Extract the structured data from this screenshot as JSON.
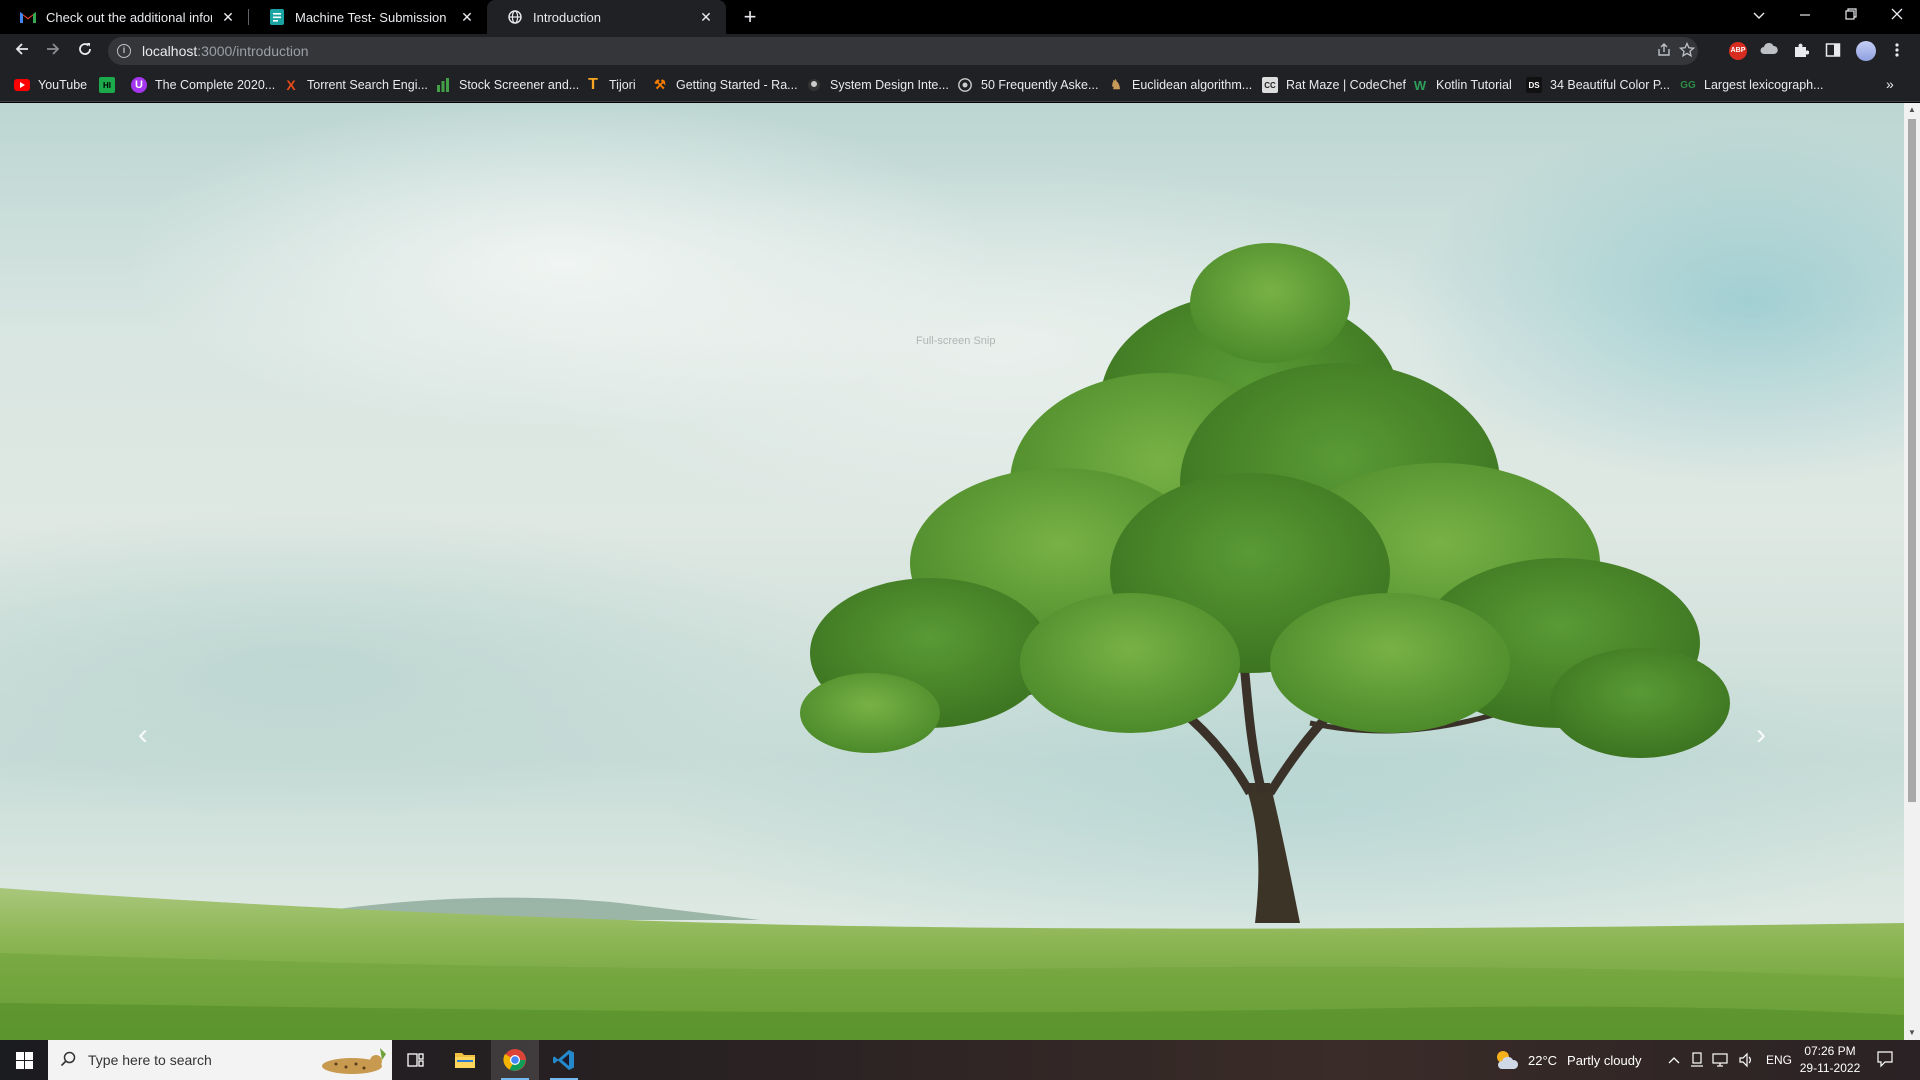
{
  "browser": {
    "tabs": [
      {
        "title": "Check out the additional informa",
        "icon": "gmail-icon",
        "active": false
      },
      {
        "title": "Machine Test- Submission",
        "icon": "forms-icon",
        "active": false
      },
      {
        "title": "Introduction",
        "icon": "globe-icon",
        "active": true
      }
    ],
    "new_tab_label": "+",
    "address": {
      "host": "localhost",
      "path": ":3000/introduction"
    },
    "bookmarks": [
      {
        "label": "YouTube",
        "icon": "youtube-icon",
        "color": "#ff0000"
      },
      {
        "label": "",
        "icon": "hackerrank-icon",
        "color": "#1ba94c"
      },
      {
        "label": "The Complete 2020...",
        "icon": "udemy-icon",
        "color": "#a435f0"
      },
      {
        "label": "Torrent Search Engi...",
        "icon": "x-icon",
        "color": "#e64a19"
      },
      {
        "label": "Stock Screener and...",
        "icon": "bars-icon",
        "color": "#43a047"
      },
      {
        "label": "Tijori",
        "icon": "t-icon",
        "color": "#f5a623"
      },
      {
        "label": "Getting Started - Ra...",
        "icon": "react-icon",
        "color": "#f57c00"
      },
      {
        "label": "System Design Inte...",
        "icon": "github-icon",
        "color": "#cccccc"
      },
      {
        "label": "50 Frequently Aske...",
        "icon": "medium-icon",
        "color": "#cccccc"
      },
      {
        "label": "Euclidean algorithm...",
        "icon": "wiki-icon",
        "color": "#c79a5a"
      },
      {
        "label": "Rat Maze | CodeChef",
        "icon": "codechef-icon",
        "color": "#cccccc"
      },
      {
        "label": "Kotlin Tutorial",
        "icon": "w3-icon",
        "color": "#2e9e5b"
      },
      {
        "label": "34 Beautiful Color P...",
        "icon": "ds-icon",
        "color": "#ffffff"
      },
      {
        "label": "Largest lexicograph...",
        "icon": "gfg-icon",
        "color": "#2f8d46"
      }
    ],
    "bookmarks_more": "»"
  },
  "page": {
    "snip_label": "Full-screen Snip",
    "prev_arrow": "‹",
    "next_arrow": "›"
  },
  "taskbar": {
    "search_placeholder": "Type here to search",
    "weather": {
      "temp": "22°C",
      "condition": "Partly cloudy"
    },
    "language": "ENG",
    "time": "07:26 PM",
    "date": "29-11-2022"
  }
}
